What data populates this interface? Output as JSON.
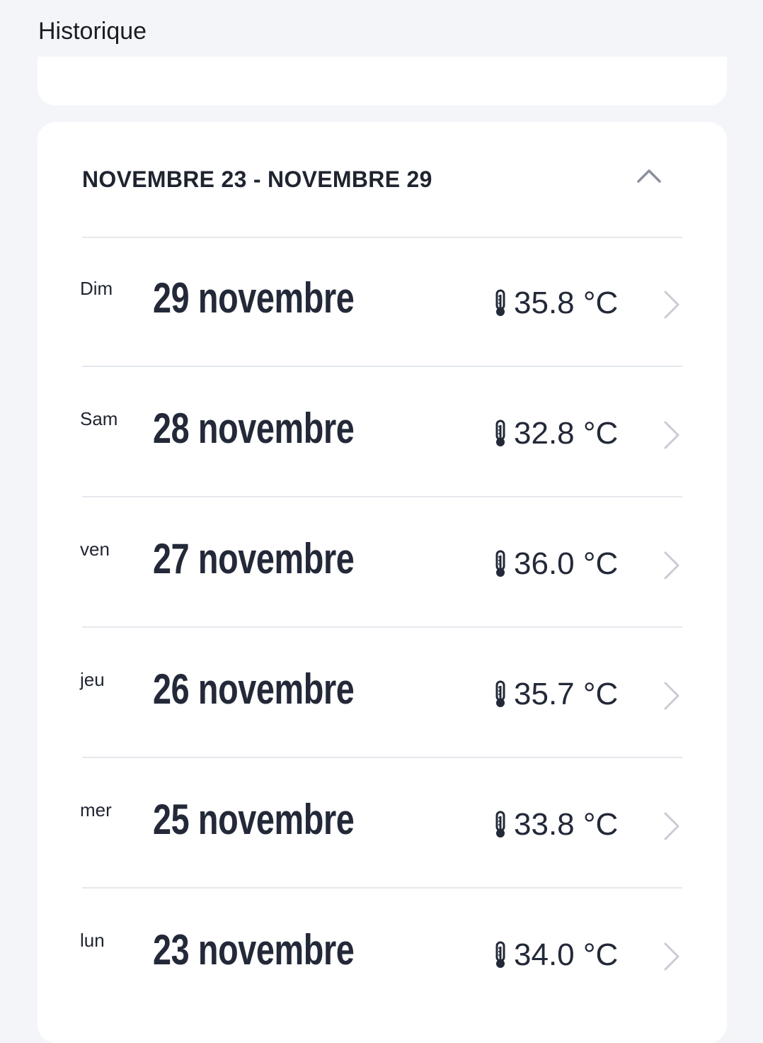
{
  "header": {
    "title": "Historique"
  },
  "week": {
    "range_label": "NOVEMBRE 23 - NOVEMBRE 29",
    "expanded": true
  },
  "days": [
    {
      "weekday": "Dim",
      "date": "29 novembre",
      "temperature": "35.8 °C"
    },
    {
      "weekday": "Sam",
      "date": "28 novembre",
      "temperature": "32.8 °C"
    },
    {
      "weekday": "ven",
      "date": "27 novembre",
      "temperature": "36.0 °C"
    },
    {
      "weekday": "jeu",
      "date": "26 novembre",
      "temperature": "35.7 °C"
    },
    {
      "weekday": "mer",
      "date": "25 novembre",
      "temperature": "33.8 °C"
    },
    {
      "weekday": "lun",
      "date": "23 novembre",
      "temperature": "34.0 °C"
    }
  ],
  "icons": {
    "collapse": "chevron-up-icon",
    "temperature": "thermometer-icon",
    "row_action": "chevron-right-icon"
  },
  "colors": {
    "background": "#f4f5f9",
    "card": "#ffffff",
    "text": "#1f2430",
    "divider": "#e6e8ee",
    "chevron": "#c9ccd4"
  }
}
